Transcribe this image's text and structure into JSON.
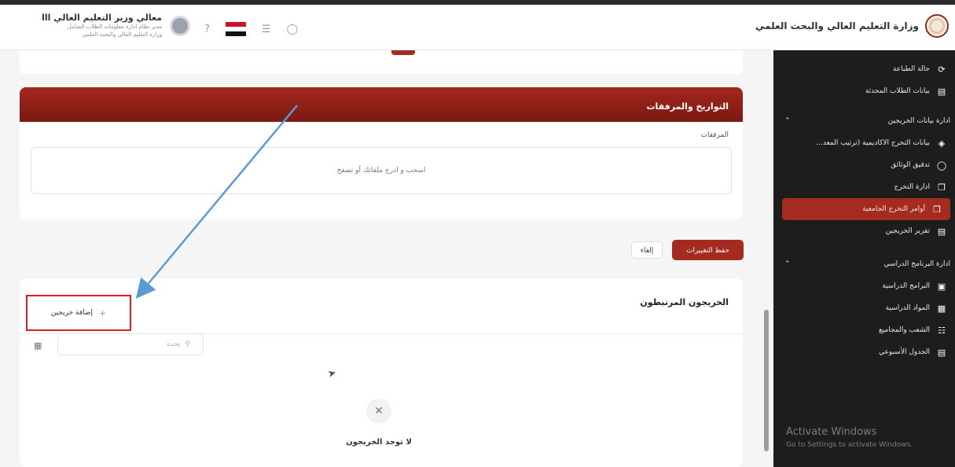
{
  "header": {
    "ministry_name": "وزارة التعليم العالي والبحث العلمي",
    "user": {
      "name": "معالي وزير التعليم العالي ااا",
      "role": "مدير نظام ادارة معلومات الطلاب الشامل",
      "org": "وزارة التعليم العالي والبحث العلمي"
    },
    "icons": [
      "avatar",
      "help-icon",
      "flag-icon",
      "menu-icon",
      "notification-icon"
    ]
  },
  "sidebar": {
    "items": [
      {
        "label": "حالة الطباعة",
        "icon": "refresh-icon"
      },
      {
        "label": "بيانات الطلاب المحدثة",
        "icon": "file-icon"
      },
      {
        "label": "ادارة بيانات الخريجين",
        "section": true
      },
      {
        "label": "بيانات التخرج الاكاديمية (ترتيب المعد...",
        "icon": "cap-icon"
      },
      {
        "label": "تدقيق الوثائق",
        "icon": "shield-icon"
      },
      {
        "label": "ادارة التخرج",
        "icon": "copy-icon"
      },
      {
        "label": "أوامر التخرج الجامعية",
        "icon": "copy-icon",
        "active": true
      },
      {
        "label": "تقرير الخريجين",
        "icon": "doc-icon"
      },
      {
        "label": "ادارة البرنامج الدراسي",
        "section": true
      },
      {
        "label": "البرامج الدراسية",
        "icon": "monitor-icon"
      },
      {
        "label": "المواد الدراسية",
        "icon": "books-icon"
      },
      {
        "label": "الشعب والمجاميع",
        "icon": "network-icon"
      },
      {
        "label": "الجدول الأسبوعي",
        "icon": "calendar-icon"
      }
    ]
  },
  "dates_panel": {
    "title": "التواريخ والمرفقات",
    "attachments_label": "المرفقات",
    "dropzone_text": "اسحب و ادرج ملفاتك أو تصفح"
  },
  "actions": {
    "save": "حفظ التغييرات",
    "cancel": "إلغاء"
  },
  "graduates": {
    "title": "الخريجون المرتبطون",
    "add_button": "إضافة خريجين",
    "search_placeholder": "بحث",
    "empty_text": "لا توجد الخريجون"
  },
  "watermark": {
    "line1": "Activate Windows",
    "line2": "Go to Settings to activate Windows."
  },
  "colors": {
    "brand": "#a52a20",
    "highlight_box": "#e51b23",
    "annotation_arrow": "#5b9bd5"
  }
}
